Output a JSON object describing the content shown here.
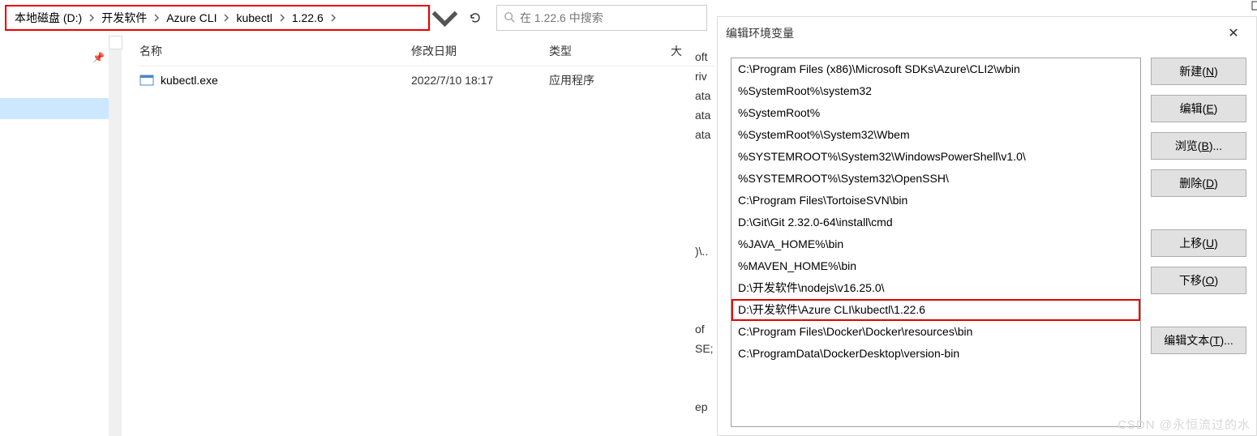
{
  "explorer": {
    "breadcrumb": [
      "本地磁盘 (D:)",
      "开发软件",
      "Azure CLI",
      "kubectl",
      "1.22.6"
    ],
    "search_placeholder": "在 1.22.6 中搜索",
    "columns": {
      "name": "名称",
      "date": "修改日期",
      "type": "类型",
      "size": "大"
    },
    "files": [
      {
        "name": "kubectl.exe",
        "date": "2022/7/10 18:17",
        "type": "应用程序"
      }
    ]
  },
  "fragments": [
    "oft",
    "riv",
    "ata",
    "ata",
    "ata",
    "",
    "",
    "",
    "",
    "",
    ")\\..",
    "",
    "",
    "",
    "of",
    "SE;",
    "",
    "",
    "ep"
  ],
  "dialog": {
    "title": "编辑环境变量",
    "items": [
      "C:\\Program Files (x86)\\Microsoft SDKs\\Azure\\CLI2\\wbin",
      "%SystemRoot%\\system32",
      "%SystemRoot%",
      "%SystemRoot%\\System32\\Wbem",
      "%SYSTEMROOT%\\System32\\WindowsPowerShell\\v1.0\\",
      "%SYSTEMROOT%\\System32\\OpenSSH\\",
      "C:\\Program Files\\TortoiseSVN\\bin",
      "D:\\Git\\Git 2.32.0-64\\install\\cmd",
      "%JAVA_HOME%\\bin",
      "%MAVEN_HOME%\\bin",
      "D:\\开发软件\\nodejs\\v16.25.0\\",
      "D:\\开发软件\\Azure CLI\\kubectl\\1.22.6",
      "C:\\Program Files\\Docker\\Docker\\resources\\bin",
      "C:\\ProgramData\\DockerDesktop\\version-bin"
    ],
    "highlight_index": 11,
    "buttons": {
      "new": "新建(N)",
      "edit": "编辑(E)",
      "browse": "浏览(B)...",
      "delete": "删除(D)",
      "up": "上移(U)",
      "down": "下移(O)",
      "edit_text": "编辑文本(T)..."
    }
  },
  "watermark": "CSDN @永恒流过的水"
}
